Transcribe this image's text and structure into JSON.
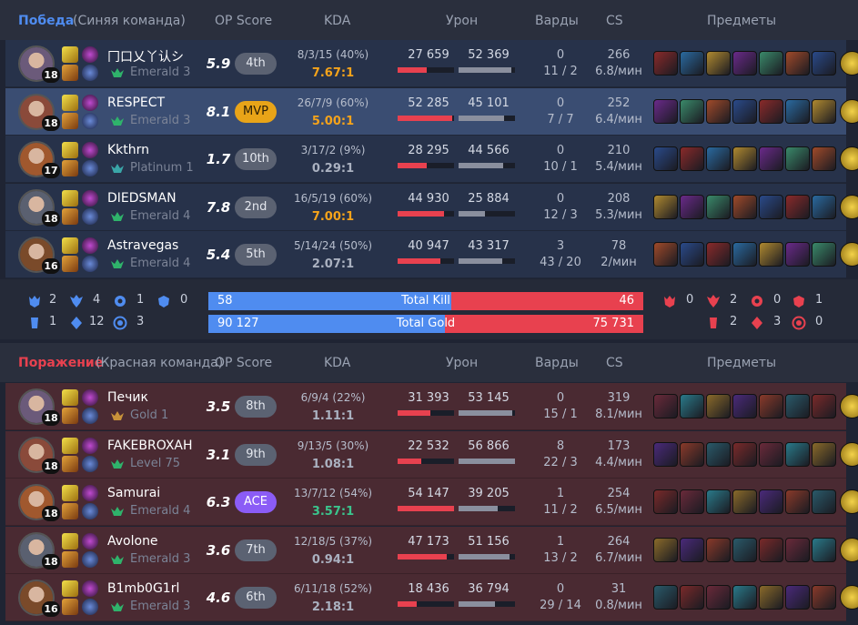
{
  "blue": {
    "result": "Победа",
    "team": "(Синяя команда)",
    "headers": {
      "op": "OP Score",
      "kda": "KDA",
      "dmg": "Урон",
      "wards": "Варды",
      "cs": "CS",
      "items": "Предметы"
    },
    "players": [
      {
        "name": "冂口乂丫认シ",
        "level": "18",
        "rank": "Emerald 3",
        "op": "5.9",
        "badge": "4th",
        "kda": "8/3/15 (40%)",
        "ratio": "7.67:1",
        "dealt": "27 659",
        "taken": "52 369",
        "dealt_pct": 0.51,
        "taken_pct": 0.93,
        "wards": "0",
        "wards2": "11 / 2",
        "cs": "266",
        "cspm": "6.8/мин"
      },
      {
        "name": "RESPECT",
        "level": "18",
        "rank": "Emerald 3",
        "op": "8.1",
        "badge": "MVP",
        "kda": "26/7/9 (60%)",
        "ratio": "5.00:1",
        "dealt": "52 285",
        "taken": "45 101",
        "dealt_pct": 0.96,
        "taken_pct": 0.8,
        "wards": "0",
        "wards2": "7 / 7",
        "cs": "252",
        "cspm": "6.4/мин"
      },
      {
        "name": "Kkthrn",
        "level": "17",
        "rank": "Platinum 1",
        "op": "1.7",
        "badge": "10th",
        "kda": "3/17/2 (9%)",
        "ratio": "0.29:1",
        "dealt": "28 295",
        "taken": "44 566",
        "dealt_pct": 0.52,
        "taken_pct": 0.79,
        "wards": "0",
        "wards2": "10 / 1",
        "cs": "210",
        "cspm": "5.4/мин"
      },
      {
        "name": "DIEDSMAN",
        "level": "18",
        "rank": "Emerald 4",
        "op": "7.8",
        "badge": "2nd",
        "kda": "16/5/19 (60%)",
        "ratio": "7.00:1",
        "dealt": "44 930",
        "taken": "25 884",
        "dealt_pct": 0.83,
        "taken_pct": 0.46,
        "wards": "0",
        "wards2": "12 / 3",
        "cs": "208",
        "cspm": "5.3/мин"
      },
      {
        "name": "Astravegas",
        "level": "16",
        "rank": "Emerald 4",
        "op": "5.4",
        "badge": "5th",
        "kda": "5/14/24 (50%)",
        "ratio": "2.07:1",
        "dealt": "40 947",
        "taken": "43 317",
        "dealt_pct": 0.75,
        "taken_pct": 0.77,
        "wards": "3",
        "wards2": "43 / 20",
        "cs": "78",
        "cspm": "2/мин"
      }
    ]
  },
  "objectives": {
    "blue": {
      "baron": "2",
      "dragon": "4",
      "herald": "1",
      "grub": "0",
      "tower": "1",
      "inhib": "12",
      "other": "3"
    },
    "red": {
      "baron": "0",
      "dragon": "2",
      "herald": "0",
      "grub": "1",
      "tower": "2",
      "inhib": "3",
      "other": "0"
    },
    "kill": {
      "blue": "58",
      "label": "Total Kill",
      "red": "46",
      "blue_share": 0.558
    },
    "gold": {
      "blue": "90 127",
      "label": "Total Gold",
      "red": "75 731",
      "blue_share": 0.543
    }
  },
  "red": {
    "result": "Поражение",
    "team": "(Красная команда)",
    "headers": {
      "op": "OP Score",
      "kda": "KDA",
      "dmg": "Урон",
      "wards": "Варды",
      "cs": "CS",
      "items": "Предметы"
    },
    "players": [
      {
        "name": "Печик",
        "level": "18",
        "rank": "Gold 1",
        "op": "3.5",
        "badge": "8th",
        "kda": "6/9/4 (22%)",
        "ratio": "1.11:1",
        "dealt": "31 393",
        "taken": "53 145",
        "dealt_pct": 0.58,
        "taken_pct": 0.95,
        "wards": "0",
        "wards2": "15 / 1",
        "cs": "319",
        "cspm": "8.1/мин"
      },
      {
        "name": "FAKEBROXAH",
        "level": "18",
        "rank": "Level 75",
        "op": "3.1",
        "badge": "9th",
        "kda": "9/13/5 (30%)",
        "ratio": "1.08:1",
        "dealt": "22 532",
        "taken": "56 866",
        "dealt_pct": 0.42,
        "taken_pct": 1.0,
        "wards": "8",
        "wards2": "22 / 3",
        "cs": "173",
        "cspm": "4.4/мин"
      },
      {
        "name": "Samurai",
        "level": "18",
        "rank": "Emerald 4",
        "op": "6.3",
        "badge": "ACE",
        "kda": "13/7/12 (54%)",
        "ratio": "3.57:1",
        "dealt": "54 147",
        "taken": "39 205",
        "dealt_pct": 1.0,
        "taken_pct": 0.69,
        "wards": "1",
        "wards2": "11 / 2",
        "cs": "254",
        "cspm": "6.5/мин"
      },
      {
        "name": "Avolone",
        "level": "18",
        "rank": "Emerald 3",
        "op": "3.6",
        "badge": "7th",
        "kda": "12/18/5 (37%)",
        "ratio": "0.94:1",
        "dealt": "47 173",
        "taken": "51 156",
        "dealt_pct": 0.87,
        "taken_pct": 0.9,
        "wards": "1",
        "wards2": "13 / 2",
        "cs": "264",
        "cspm": "6.7/мин"
      },
      {
        "name": "B1mb0G1rl",
        "level": "16",
        "rank": "Emerald 3",
        "op": "4.6",
        "badge": "6th",
        "kda": "6/11/18 (52%)",
        "ratio": "2.18:1",
        "dealt": "18 436",
        "taken": "36 794",
        "dealt_pct": 0.34,
        "taken_pct": 0.65,
        "wards": "0",
        "wards2": "29 / 14",
        "cs": "31",
        "cspm": "0.8/мин"
      }
    ]
  },
  "colors": {
    "blue": "#4f8cf0",
    "red": "#e8414f",
    "mvp": "#e8a418",
    "ace": "#8b5cf6",
    "gold_ratio": "#f5a31a",
    "green_ratio": "#3bc48d",
    "emerald": "#2fb36b"
  }
}
